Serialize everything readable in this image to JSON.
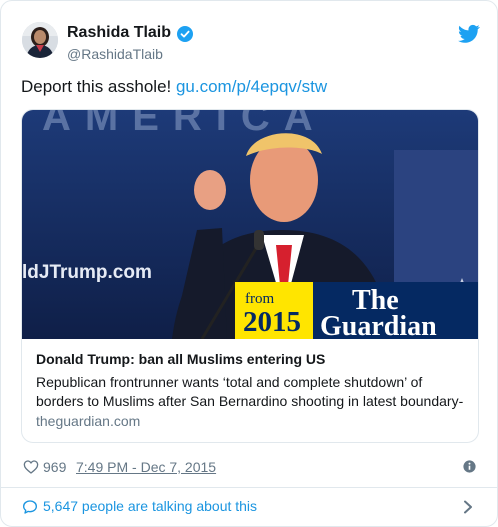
{
  "author": {
    "display_name": "Rashida Tlaib",
    "handle": "@RashidaTlaib"
  },
  "icons": {
    "verified": "verified-badge-icon",
    "twitter": "twitter-bird-icon",
    "like": "heart-icon",
    "info": "info-icon",
    "conversation": "speech-bubble-icon",
    "more": "chevron-right-icon"
  },
  "tweet": {
    "text": "Deport this asshole! ",
    "link": "gu.com/p/4epqv/stw"
  },
  "card": {
    "title": "Donald Trump: ban all Muslims entering US",
    "description_line1": "Republican frontrunner wants ‘total and complete shutdown’ of",
    "description_line2": "borders to Muslims after San Bernardino shooting in latest boundary-",
    "domain": "theguardian.com",
    "image": {
      "backdrop_text": "AMERICA",
      "sign_text": "ldJTrump.com",
      "badge_from": "from",
      "badge_year": "2015",
      "badge_brand_line1": "The",
      "badge_brand_line2": "Guardian"
    }
  },
  "meta": {
    "likes": "969",
    "timestamp": "7:49 PM - Dec 7, 2015"
  },
  "talking": "5,647 people are talking about this",
  "colors": {
    "link": "#1b95e0",
    "muted": "#657786",
    "border": "#e1e8ed",
    "guardian_navy": "#052962",
    "guardian_yellow": "#ffe500"
  }
}
